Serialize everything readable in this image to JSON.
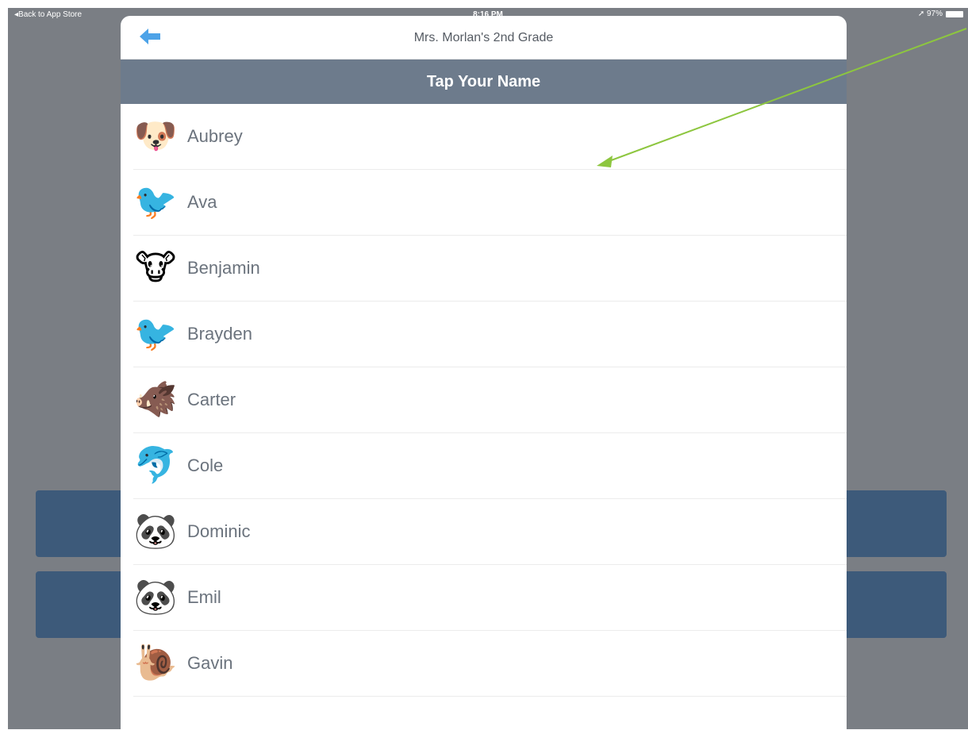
{
  "statusbar": {
    "back_label": "◂Back to App Store",
    "time": "8:16 PM",
    "battery": "➚ 97%"
  },
  "modal": {
    "title": "Mrs. Morlan's 2nd Grade",
    "banner": "Tap Your Name"
  },
  "students": [
    {
      "name": "Aubrey",
      "icon": "dog-face-icon",
      "glyph": "🐶"
    },
    {
      "name": "Ava",
      "icon": "bird-icon",
      "glyph": "🐦"
    },
    {
      "name": "Benjamin",
      "icon": "cow-face-icon",
      "glyph": "🐮"
    },
    {
      "name": "Brayden",
      "icon": "bird-icon",
      "glyph": "🐦"
    },
    {
      "name": "Carter",
      "icon": "boar-icon",
      "glyph": "🐗"
    },
    {
      "name": "Cole",
      "icon": "dolphin-icon",
      "glyph": "🐬"
    },
    {
      "name": "Dominic",
      "icon": "panda-face-icon",
      "glyph": "🐼"
    },
    {
      "name": "Emil",
      "icon": "panda-face-icon",
      "glyph": "🐼"
    },
    {
      "name": "Gavin",
      "icon": "snail-icon",
      "glyph": "🐌"
    }
  ],
  "colors": {
    "accent_blue": "#4da3e8",
    "banner_bg": "#6d7b8c",
    "annotation_arrow": "#8dc63f"
  }
}
